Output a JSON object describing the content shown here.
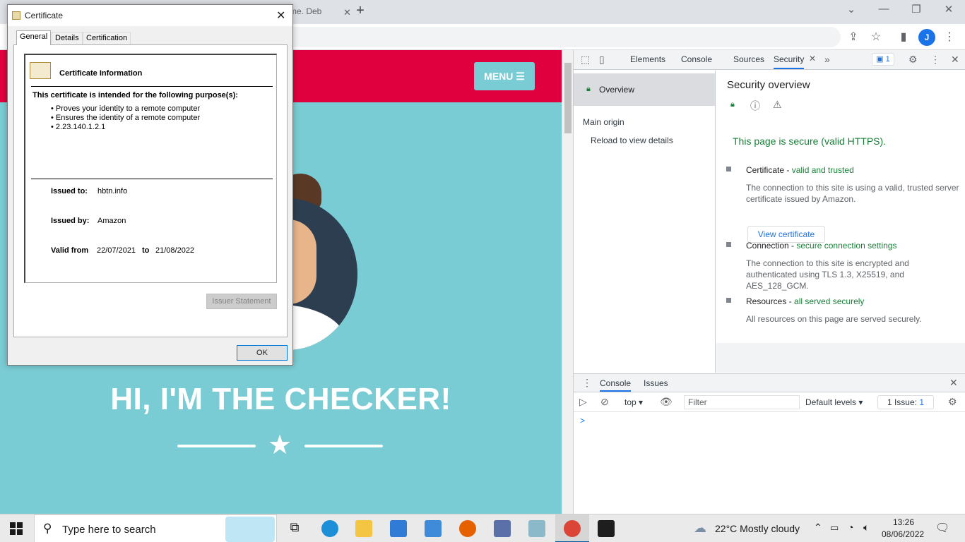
{
  "browser": {
    "tab_fragment": "me. Deb",
    "new_tab": "+",
    "avatar_initial": "J",
    "window_controls": [
      "⌄",
      "—",
      "❐",
      "✕"
    ]
  },
  "page": {
    "menu_label": "MENU ☰",
    "headline": "HI, I'M THE CHECKER!",
    "colors": {
      "header": "#e1003e",
      "background": "#7accd4"
    }
  },
  "devtools": {
    "tabs": [
      "Elements",
      "Console",
      "Sources",
      "Security"
    ],
    "issues_badge": "1",
    "sidebar": {
      "overview": "Overview",
      "main_origin": "Main origin",
      "reload_hint": "Reload to view details"
    },
    "security": {
      "title": "Security overview",
      "summary": "This page is secure (valid HTTPS).",
      "certificate": {
        "label": "Certificate - ",
        "status": "valid and trusted",
        "desc": "The connection to this site is using a valid, trusted server certificate issued by Amazon.",
        "button": "View certificate"
      },
      "connection": {
        "label": "Connection - ",
        "status": "secure connection settings",
        "desc": "The connection to this site is encrypted and authenticated using TLS 1.3, X25519, and AES_128_GCM."
      },
      "resources": {
        "label": "Resources - ",
        "status": "all served securely",
        "desc": "All resources on this page are served securely."
      }
    },
    "drawer": {
      "tabs": [
        "Console",
        "Issues"
      ],
      "context": "top",
      "filter_placeholder": "Filter",
      "levels": "Default levels",
      "issues": "1 Issue:",
      "issues_count": "1",
      "prompt": ">"
    }
  },
  "certificate_dialog": {
    "title": "Certificate",
    "tabs": [
      "General",
      "Details",
      "Certification Path"
    ],
    "heading": "Certificate Information",
    "purpose_heading": "This certificate is intended for the following purpose(s):",
    "purposes": [
      "• Proves your identity to a remote computer",
      "• Ensures the identity of a remote computer",
      "• 2.23.140.1.2.1"
    ],
    "issued_to_label": "Issued to:",
    "issued_to": "hbtn.info",
    "issued_by_label": "Issued by:",
    "issued_by": "Amazon",
    "valid_from_label": "Valid from",
    "valid_from": "22/07/2021",
    "to_label": "to",
    "valid_to": "21/08/2022",
    "issuer_button": "Issuer Statement",
    "ok_button": "OK"
  },
  "taskbar": {
    "search_placeholder": "Type here to search",
    "weather": "22°C  Mostly cloudy",
    "time": "13:26",
    "date": "08/06/2022"
  }
}
